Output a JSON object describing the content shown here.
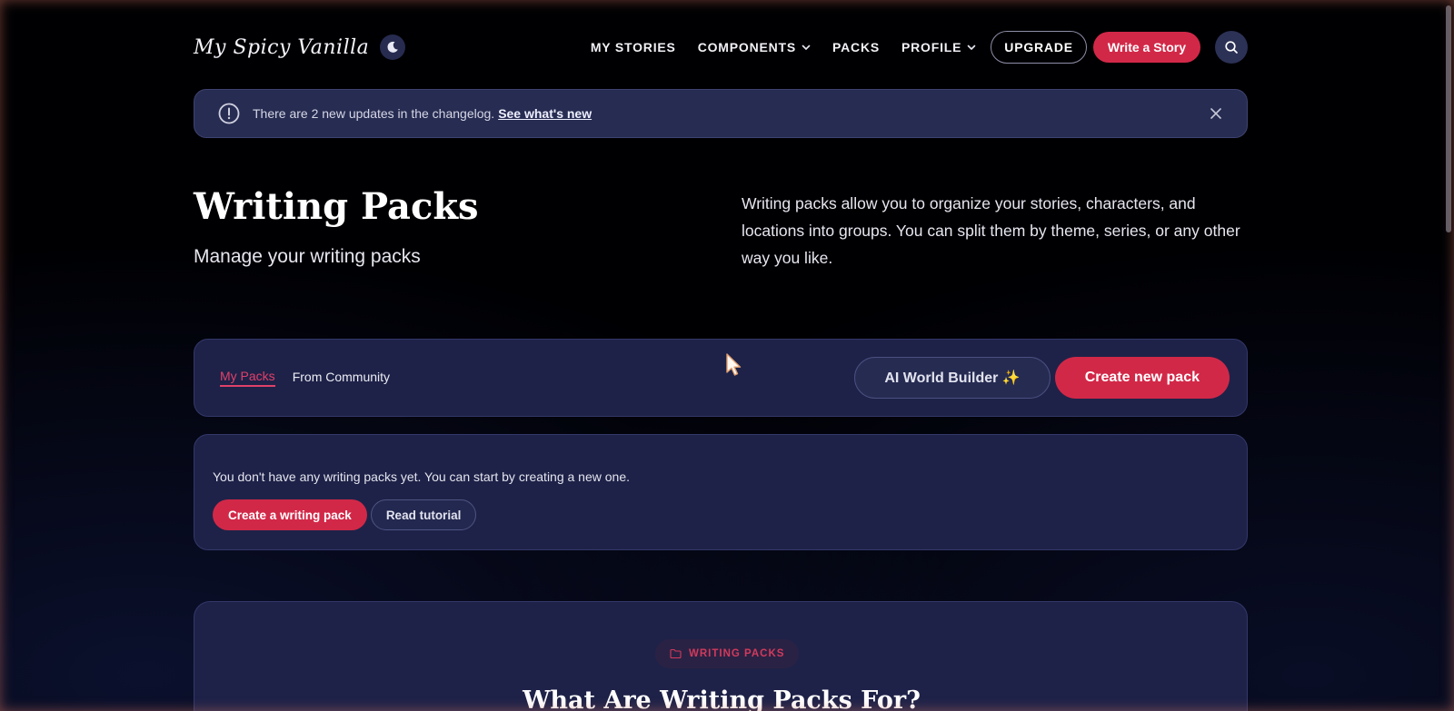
{
  "app": {
    "logo_text": "My Spicy Vanilla",
    "theme_icon": "moon-icon"
  },
  "nav": {
    "items": [
      {
        "label": "MY STORIES",
        "dropdown": false
      },
      {
        "label": "COMPONENTS",
        "dropdown": true
      },
      {
        "label": "PACKS",
        "dropdown": false
      },
      {
        "label": "PROFILE",
        "dropdown": true
      }
    ],
    "upgrade_label": "UPGRADE",
    "write_label": "Write a Story",
    "search_icon": "search-icon"
  },
  "banner": {
    "icon": "alert-circle-icon",
    "text": "There are 2 new updates in the changelog.",
    "link": "See what's new",
    "close_icon": "close-icon"
  },
  "hero": {
    "title": "Writing Packs",
    "subtitle": "Manage your writing packs",
    "description": "Writing packs allow you to organize your stories, characters, and locations into groups. You can split them by theme, series, or any other way you like."
  },
  "tabs": {
    "items": [
      {
        "label": "My Packs",
        "active": true
      },
      {
        "label": "From Community",
        "active": false
      }
    ],
    "ai_button": "AI World Builder ✨",
    "create_button": "Create new pack"
  },
  "empty_state": {
    "text": "You don't have any writing packs yet. You can start by creating a new one.",
    "create_button": "Create a writing pack",
    "tutorial_button": "Read tutorial"
  },
  "info_section": {
    "pill_icon": "folder-icon",
    "pill_label": "WRITING PACKS",
    "title": "What Are Writing Packs For?"
  },
  "colors": {
    "accent": "#d22848",
    "card_bg": "#1e2248",
    "banner_bg": "#272c52",
    "page_bg": "#000003"
  }
}
